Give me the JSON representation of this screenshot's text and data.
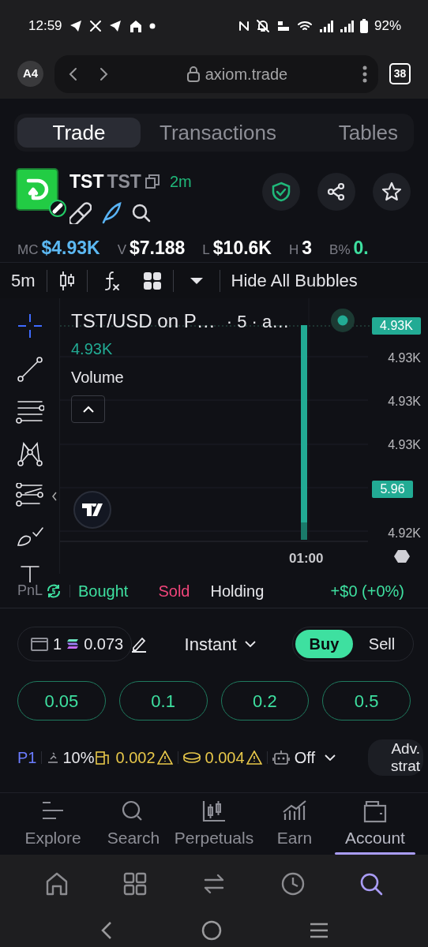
{
  "status_bar": {
    "time": "12:59",
    "battery": "92%"
  },
  "browser": {
    "profile": "A4",
    "url": "axiom.trade",
    "tab_count": "38"
  },
  "tabs": [
    {
      "label": "Trade",
      "selected": true
    },
    {
      "label": "Transactions",
      "selected": false
    },
    {
      "label": "Tables",
      "selected": false
    }
  ],
  "token": {
    "ticker": "TST",
    "name": "TST",
    "age": "2m"
  },
  "stats": [
    {
      "label": "MC",
      "value": "$4.93K",
      "color": "#5cb8f2"
    },
    {
      "label": "V",
      "value": "$7.188",
      "color": "#ffffff"
    },
    {
      "label": "L",
      "value": "$10.6K",
      "color": "#ffffff"
    },
    {
      "label": "H",
      "value": "3",
      "color": "#ffffff"
    },
    {
      "label": "B%",
      "value": "0.",
      "color": "#3ee0a0"
    }
  ],
  "chart_toolbar": {
    "interval": "5m",
    "bubbles_button": "Hide All Bubbles"
  },
  "chart": {
    "title": "TST/USD on P…",
    "interval_label": "· 5 · a…",
    "price": "4.93K",
    "volume_label": "Volume",
    "time_label": "01:00",
    "price_axis": [
      {
        "label": "4.93K",
        "kind": "tick"
      },
      {
        "label": "4.93K",
        "kind": "tick"
      },
      {
        "label": "4.93K",
        "kind": "tick"
      },
      {
        "label": "4.92K",
        "kind": "tick"
      }
    ],
    "badges": [
      {
        "label": "4.93K",
        "kind": "price"
      },
      {
        "label": "5.96",
        "kind": "volume"
      }
    ]
  },
  "pnl": {
    "label": "PnL",
    "bought": "Bought",
    "sold": "Sold",
    "holding": "Holding",
    "result": "+$0 (+0%)"
  },
  "trade": {
    "wallet_count": "1",
    "balance": "0.073",
    "mode": "Instant",
    "sides": [
      {
        "label": "Buy",
        "selected": true
      },
      {
        "label": "Sell",
        "selected": false
      }
    ]
  },
  "amounts": [
    "0.05",
    "0.1",
    "0.2",
    "0.5"
  ],
  "settings": {
    "preset": "P1",
    "slippage": "10%",
    "priority_fee": "0.002",
    "bribe": "0.004",
    "auto": "Off",
    "advanced": "Adv. strat"
  },
  "bottom_nav": [
    {
      "label": "Explore",
      "kind": "explore",
      "selected": false
    },
    {
      "label": "Search",
      "kind": "search",
      "selected": false
    },
    {
      "label": "Perpetuals",
      "kind": "perpetuals",
      "selected": false
    },
    {
      "label": "Earn",
      "kind": "earn",
      "selected": false
    },
    {
      "label": "Account",
      "kind": "account",
      "selected": true
    }
  ],
  "browser_nav": [
    {
      "kind": "home",
      "selected": false
    },
    {
      "kind": "tabs",
      "selected": false
    },
    {
      "kind": "swap",
      "selected": false
    },
    {
      "kind": "history",
      "selected": false
    },
    {
      "kind": "search",
      "selected": true
    }
  ]
}
